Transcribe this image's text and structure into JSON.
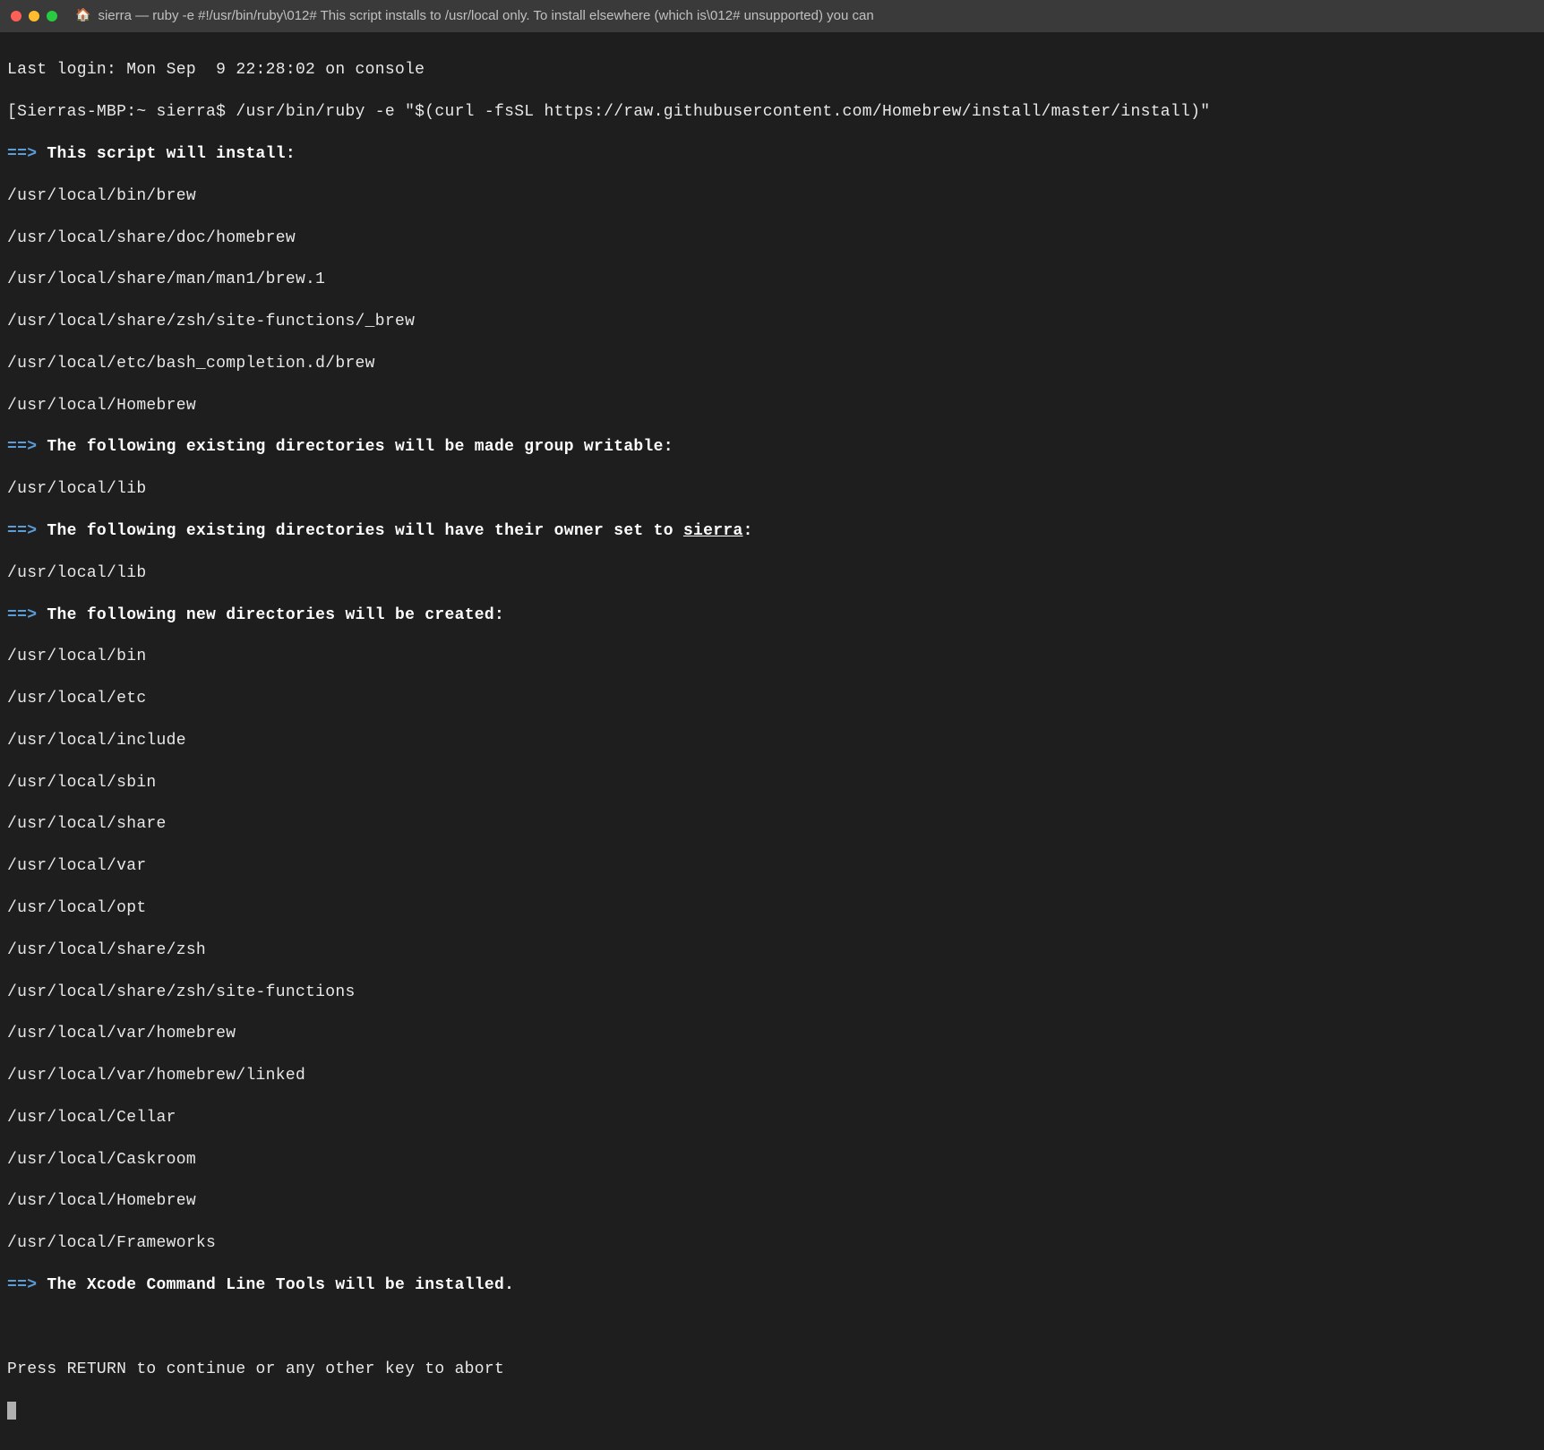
{
  "titlebar": {
    "title": "sierra — ruby -e #!/usr/bin/ruby\\012# This script installs to /usr/local only. To install elsewhere (which is\\012# unsupported) you can"
  },
  "session": {
    "last_login": "Last login: Mon Sep  9 22:28:02 on console",
    "prompt_host": "[Sierras-MBP:~ sierra$ ",
    "command": "/usr/bin/ruby -e \"$(curl -fsSL https://raw.githubusercontent.com/Homebrew/install/master/install)\""
  },
  "arrow": "==>",
  "sections": [
    {
      "heading": "This script will install:",
      "lines": [
        "/usr/local/bin/brew",
        "/usr/local/share/doc/homebrew",
        "/usr/local/share/man/man1/brew.1",
        "/usr/local/share/zsh/site-functions/_brew",
        "/usr/local/etc/bash_completion.d/brew",
        "/usr/local/Homebrew"
      ]
    },
    {
      "heading": "The following existing directories will be made group writable:",
      "lines": [
        "/usr/local/lib"
      ]
    },
    {
      "heading_pre": "The following existing directories will have their owner set to ",
      "heading_user": "sierra",
      "heading_post": ":",
      "lines": [
        "/usr/local/lib"
      ]
    },
    {
      "heading": "The following new directories will be created:",
      "lines": [
        "/usr/local/bin",
        "/usr/local/etc",
        "/usr/local/include",
        "/usr/local/sbin",
        "/usr/local/share",
        "/usr/local/var",
        "/usr/local/opt",
        "/usr/local/share/zsh",
        "/usr/local/share/zsh/site-functions",
        "/usr/local/var/homebrew",
        "/usr/local/var/homebrew/linked",
        "/usr/local/Cellar",
        "/usr/local/Caskroom",
        "/usr/local/Homebrew",
        "/usr/local/Frameworks"
      ]
    },
    {
      "heading": "The Xcode Command Line Tools will be installed.",
      "lines": []
    }
  ],
  "footer": {
    "prompt": "Press RETURN to continue or any other key to abort"
  }
}
